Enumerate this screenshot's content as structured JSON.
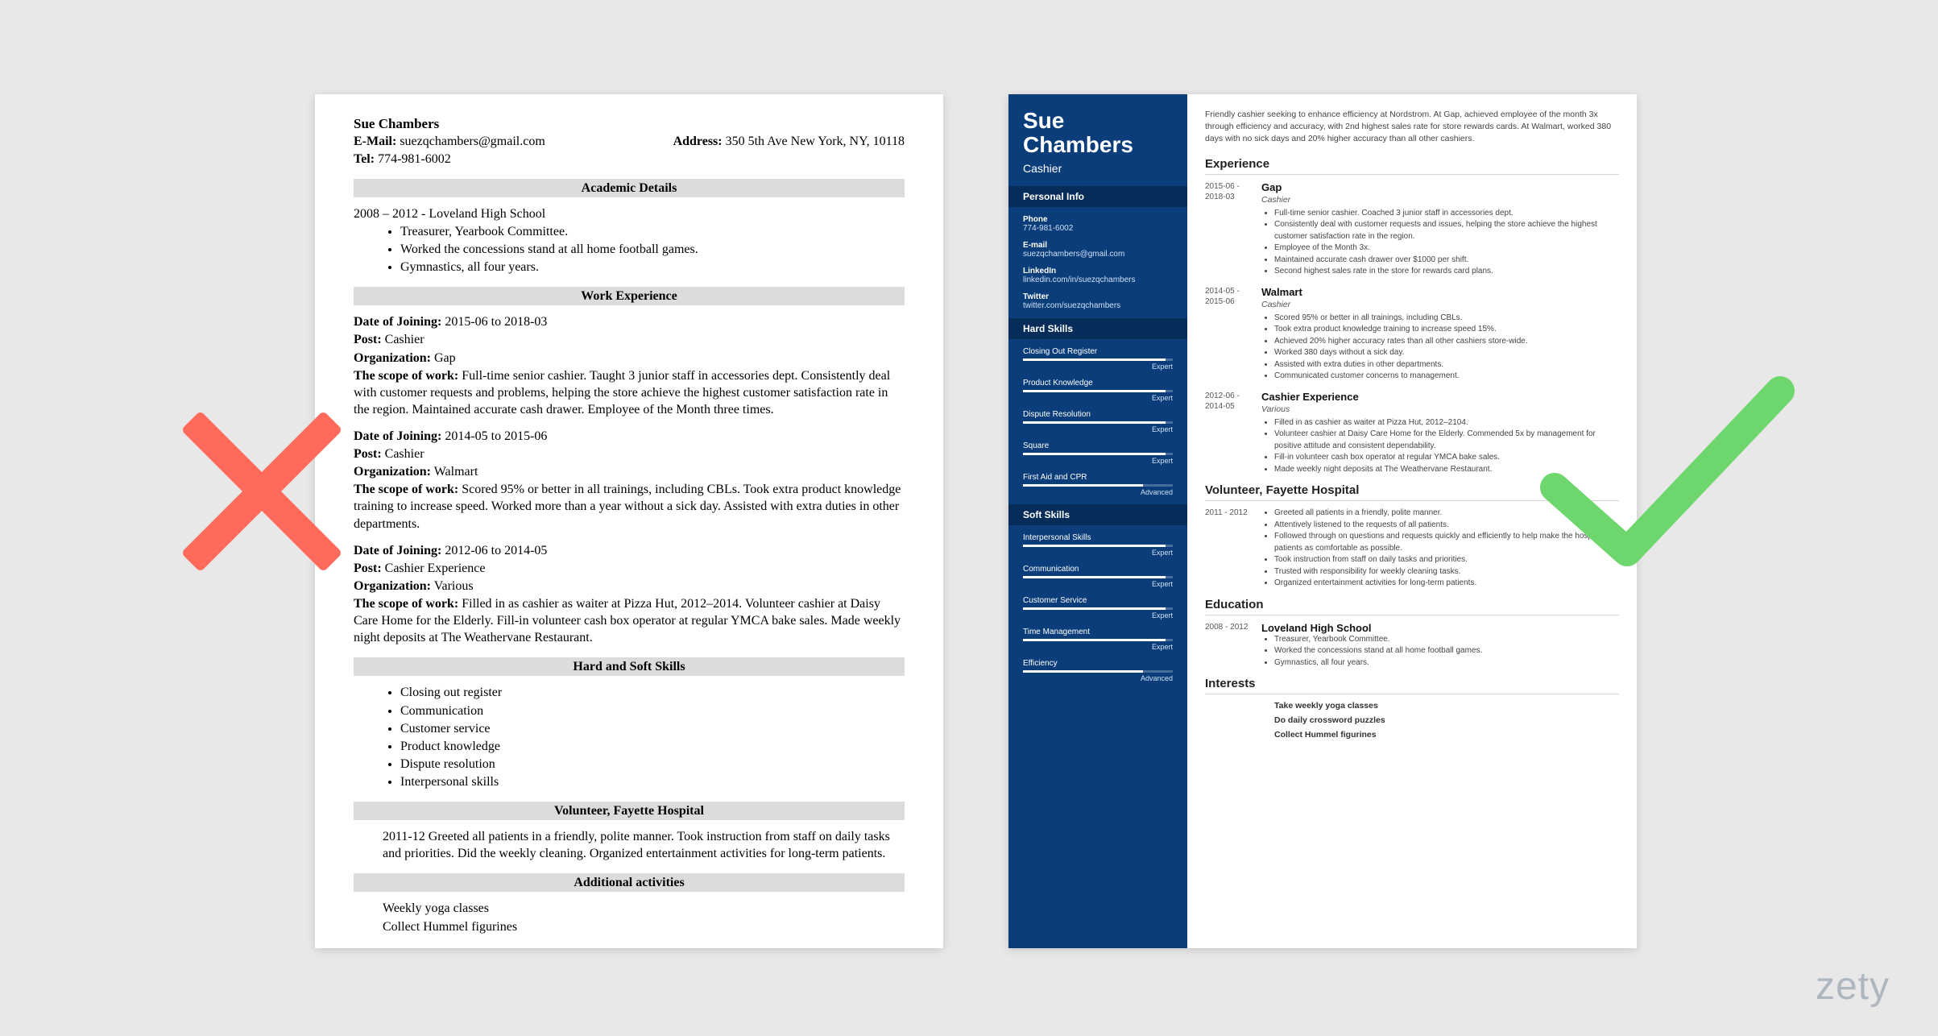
{
  "brand": "zety",
  "left": {
    "name": "Sue Chambers",
    "email_label": "E-Mail:",
    "email": "suezqchambers@gmail.com",
    "address_label": "Address:",
    "address": "350 5th Ave New York, NY, 10118",
    "tel_label": "Tel:",
    "tel": "774-981-6002",
    "sections": {
      "academic": "Academic Details",
      "work": "Work Experience",
      "skills": "Hard and Soft Skills",
      "volunteer": "Volunteer, Fayette Hospital",
      "additional": "Additional activities"
    },
    "academic_line": "2008 – 2012 - Loveland High School",
    "academic_bullets": [
      "Treasurer, Yearbook Committee.",
      "Worked the concessions stand at all home football games.",
      "Gymnastics, all four years."
    ],
    "labels": {
      "doj": "Date of Joining:",
      "post": "Post:",
      "org": "Organization:",
      "scope": "The scope of work:"
    },
    "jobs": [
      {
        "doj": "2015-06 to 2018-03",
        "post": "Cashier",
        "org": "Gap",
        "scope": "Full-time senior cashier. Taught 3 junior staff in accessories dept. Consistently deal with customer requests and problems, helping the store achieve the highest customer satisfaction rate in the region. Maintained accurate cash drawer. Employee of the Month three times."
      },
      {
        "doj": "2014-05 to 2015-06",
        "post": "Cashier",
        "org": "Walmart",
        "scope": "Scored 95% or better in all trainings, including CBLs. Took extra product knowledge training to increase speed. Worked more than a year without a sick day. Assisted with extra duties in other departments."
      },
      {
        "doj": "2012-06 to 2014-05",
        "post": "Cashier Experience",
        "org": "Various",
        "scope": "Filled in as cashier as waiter at Pizza Hut, 2012–2014. Volunteer cashier at Daisy Care Home for the Elderly. Fill-in volunteer cash box operator at regular YMCA bake sales. Made weekly night deposits at The Weathervane Restaurant."
      }
    ],
    "skills_list": [
      "Closing out register",
      "Communication",
      "Customer service",
      "Product knowledge",
      "Dispute resolution",
      "Interpersonal skills"
    ],
    "volunteer_text": "2011-12 Greeted all patients in a friendly, polite manner. Took instruction from staff on daily tasks and priorities. Did the weekly cleaning. Organized entertainment activities for long-term patients.",
    "additional": [
      "Weekly yoga classes",
      "Collect Hummel figurines"
    ]
  },
  "right": {
    "name1": "Sue",
    "name2": "Chambers",
    "role": "Cashier",
    "side_personal": "Personal Info",
    "contacts": [
      {
        "label": "Phone",
        "value": "774-981-6002"
      },
      {
        "label": "E-mail",
        "value": "suezqchambers@gmail.com"
      },
      {
        "label": "LinkedIn",
        "value": "linkedin.com/in/suezqchambers"
      },
      {
        "label": "Twitter",
        "value": "twitter.com/suezqchambers"
      }
    ],
    "side_hard": "Hard Skills",
    "hard_skills": [
      {
        "name": "Closing Out Register",
        "level": "Expert",
        "pct": 95
      },
      {
        "name": "Product Knowledge",
        "level": "Expert",
        "pct": 95
      },
      {
        "name": "Dispute Resolution",
        "level": "Expert",
        "pct": 95
      },
      {
        "name": "Square",
        "level": "Expert",
        "pct": 95
      },
      {
        "name": "First Aid and CPR",
        "level": "Advanced",
        "pct": 80
      }
    ],
    "side_soft": "Soft Skills",
    "soft_skills": [
      {
        "name": "Interpersonal Skills",
        "level": "Expert",
        "pct": 95
      },
      {
        "name": "Communication",
        "level": "Expert",
        "pct": 95
      },
      {
        "name": "Customer Service",
        "level": "Expert",
        "pct": 95
      },
      {
        "name": "Time Management",
        "level": "Expert",
        "pct": 95
      },
      {
        "name": "Efficiency",
        "level": "Advanced",
        "pct": 80
      }
    ],
    "summary": "Friendly cashier seeking to enhance efficiency at Nordstrom. At Gap, achieved employee of the month 3x through efficiency and accuracy, with 2nd highest sales rate for store rewards cards. At Walmart, worked 380 days with no sick days and 20% higher accuracy than all other cashiers.",
    "sec_experience": "Experience",
    "experience": [
      {
        "dates": "2015-06 - 2018-03",
        "heading": "Gap",
        "sub": "Cashier",
        "bullets": [
          "Full-time senior cashier. Coached 3 junior staff in accessories dept.",
          "Consistently deal with customer requests and issues, helping the store achieve the highest customer satisfaction rate in the region.",
          "Employee of the Month 3x.",
          "Maintained accurate cash drawer over $1000 per shift.",
          "Second highest sales rate in the store for rewards card plans."
        ]
      },
      {
        "dates": "2014-05 - 2015-06",
        "heading": "Walmart",
        "sub": "Cashier",
        "bullets": [
          "Scored 95% or better in all trainings, including CBLs.",
          "Took extra product knowledge training to increase speed 15%.",
          "Achieved 20% higher accuracy rates than all other cashiers store-wide.",
          "Worked 380 days without a sick day.",
          "Assisted with extra duties in other departments.",
          "Communicated customer concerns to management."
        ]
      },
      {
        "dates": "2012-06 - 2014-05",
        "heading": "Cashier Experience",
        "sub": "Various",
        "bullets": [
          "Filled in as cashier as waiter at Pizza Hut, 2012–2104.",
          "Volunteer cashier at Daisy Care Home for the Elderly. Commended 5x by management for positive attitude and consistent dependability.",
          "Fill-in volunteer cash box operator at regular YMCA bake sales.",
          "Made weekly night deposits at The Weathervane Restaurant."
        ]
      }
    ],
    "sec_volunteer": "Volunteer, Fayette Hospital",
    "volunteer": {
      "dates": "2011 - 2012",
      "bullets": [
        "Greeted all patients in a friendly, polite manner.",
        "Attentively listened to the requests of all patients.",
        "Followed through on questions and requests quickly and efficiently to help make the hospital's patients as comfortable as possible.",
        "Took instruction from staff on daily tasks and priorities.",
        "Trusted with responsibility for weekly cleaning tasks.",
        "Organized entertainment activities for long-term patients."
      ]
    },
    "sec_education": "Education",
    "education": {
      "dates": "2008 - 2012",
      "heading": "Loveland High School",
      "bullets": [
        "Treasurer, Yearbook Committee.",
        "Worked the concessions stand at all home football games.",
        "Gymnastics, all four years."
      ]
    },
    "sec_interests": "Interests",
    "interests": [
      "Take weekly yoga classes",
      "Do daily crossword puzzles",
      "Collect Hummel figurines"
    ]
  }
}
